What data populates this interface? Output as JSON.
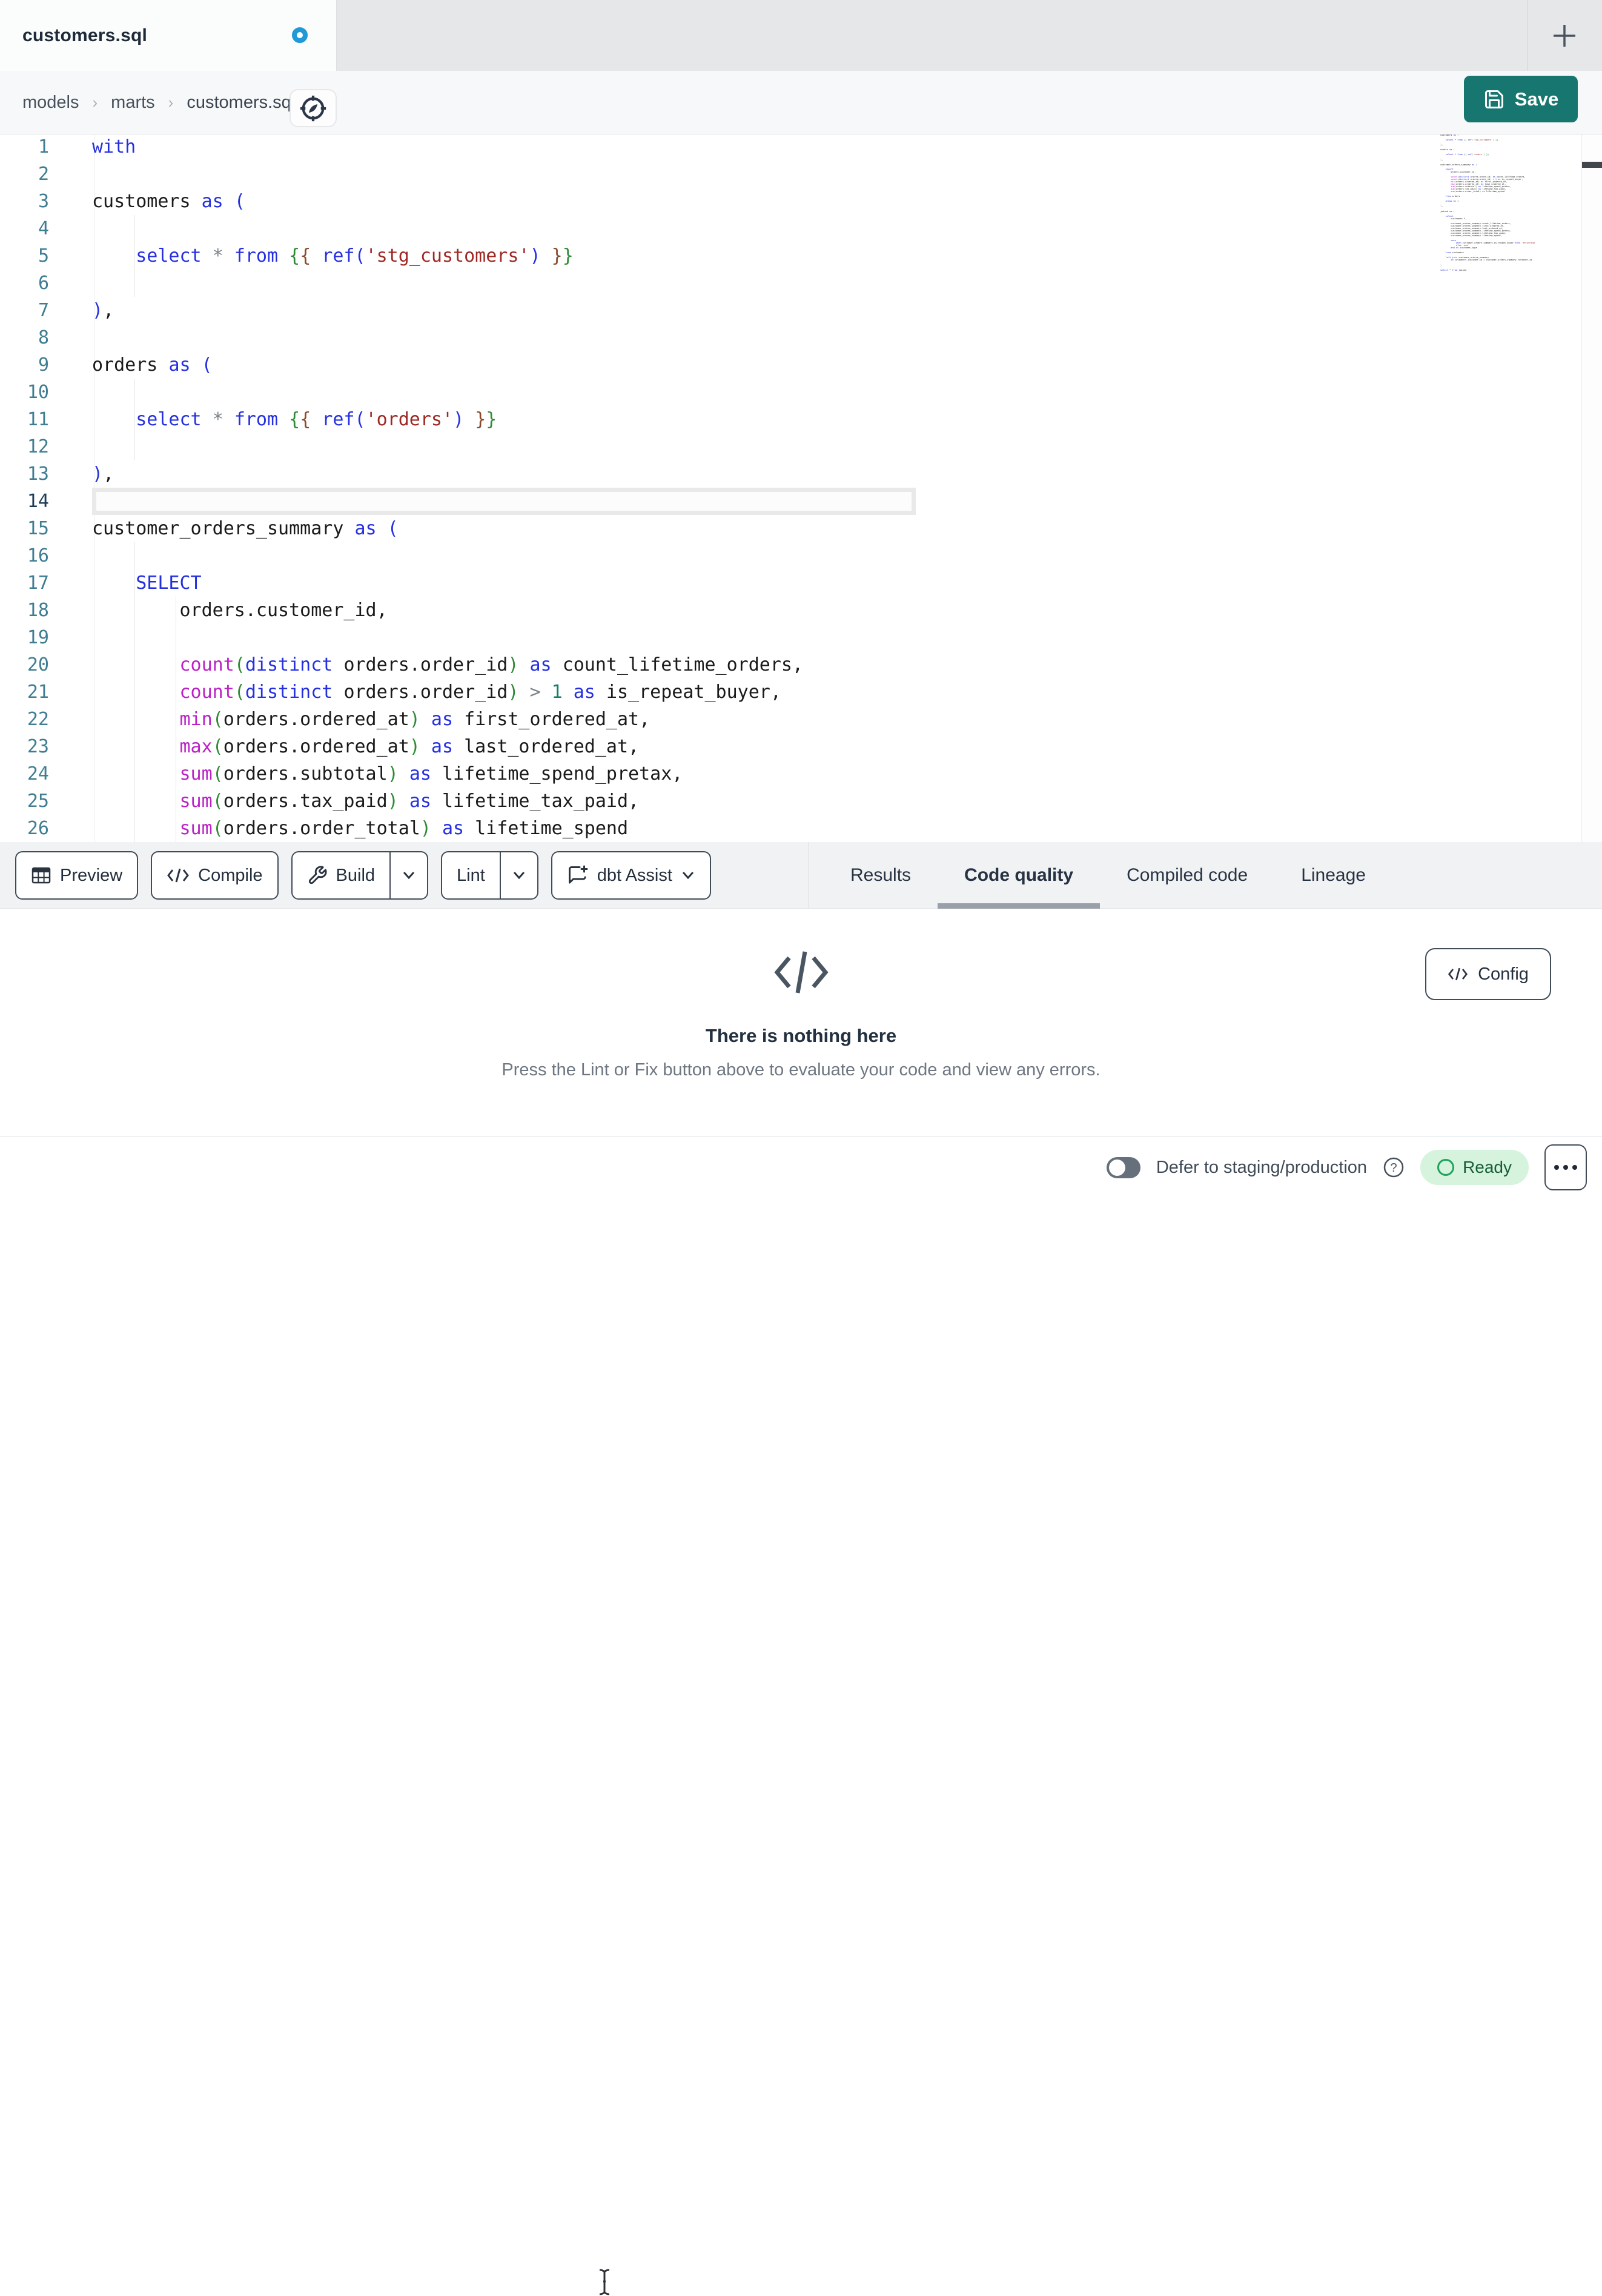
{
  "tab_bar": {
    "title": "customers.sql"
  },
  "breadcrumb": {
    "items": [
      "models",
      "marts",
      "customers.sql"
    ],
    "separator": "›"
  },
  "save_button": {
    "label": "Save"
  },
  "toolbar": {
    "preview_label": "Preview",
    "compile_label": "Compile",
    "build_label": "Build",
    "lint_label": "Lint",
    "assist_label": "dbt Assist"
  },
  "tabs": {
    "active_index": 1,
    "items": [
      {
        "label": "Results"
      },
      {
        "label": "Code quality"
      },
      {
        "label": "Compiled code"
      },
      {
        "label": "Lineage"
      }
    ]
  },
  "empty_state": {
    "title": "There is nothing here",
    "subtitle": "Press the Lint or Fix button above to evaluate your code and view any errors."
  },
  "config_button": {
    "label": "Config"
  },
  "status_bar": {
    "defer_label": "Defer to staging/production",
    "ready_label": "Ready"
  },
  "colors": {
    "accent_teal": "#17766f",
    "unsaved_dot_blue": "#1f9ad6",
    "ready_green_bg": "#d5f3dd",
    "ready_green_text": "#185f38",
    "keyword_blue": "#2430e0",
    "function_magenta": "#bb21c7",
    "string_red": "#9e2823",
    "bracket_green": "#2e8b35",
    "bracket_brown": "#884a2c",
    "line_number_teal": "#3f7d92"
  },
  "editor": {
    "active_line": 14,
    "lines": [
      [
        [
          "with",
          "kw"
        ]
      ],
      [],
      [
        [
          "customers"
        ],
        [
          " "
        ],
        [
          "as",
          "kw"
        ],
        [
          " "
        ],
        [
          "(",
          "kw"
        ]
      ],
      [],
      [
        [
          "    "
        ],
        [
          "select",
          "kw"
        ],
        [
          " "
        ],
        [
          "*",
          "op"
        ],
        [
          " "
        ],
        [
          "from",
          "kw"
        ],
        [
          " "
        ],
        [
          "{",
          "bg"
        ],
        [
          "{",
          "bb"
        ],
        [
          " "
        ],
        [
          "ref",
          "kw"
        ],
        [
          "(",
          "kw"
        ],
        [
          "'stg_customers'",
          "str"
        ],
        [
          ")",
          "kw"
        ],
        [
          " "
        ],
        [
          "}",
          "bb"
        ],
        [
          "}",
          "bg"
        ]
      ],
      [],
      [
        [
          ")",
          "kw"
        ],
        [
          ","
        ]
      ],
      [],
      [
        [
          "orders"
        ],
        [
          " "
        ],
        [
          "as",
          "kw"
        ],
        [
          " "
        ],
        [
          "(",
          "kw"
        ]
      ],
      [],
      [
        [
          "    "
        ],
        [
          "select",
          "kw"
        ],
        [
          " "
        ],
        [
          "*",
          "op"
        ],
        [
          " "
        ],
        [
          "from",
          "kw"
        ],
        [
          " "
        ],
        [
          "{",
          "bg"
        ],
        [
          "{",
          "bb"
        ],
        [
          " "
        ],
        [
          "ref",
          "kw"
        ],
        [
          "(",
          "kw"
        ],
        [
          "'orders'",
          "str"
        ],
        [
          ")",
          "kw"
        ],
        [
          " "
        ],
        [
          "}",
          "bb"
        ],
        [
          "}",
          "bg"
        ]
      ],
      [],
      [
        [
          ")",
          "kw"
        ],
        [
          ","
        ]
      ],
      [],
      [
        [
          "customer_orders_summary"
        ],
        [
          " "
        ],
        [
          "as",
          "kw"
        ],
        [
          " "
        ],
        [
          "(",
          "kw"
        ]
      ],
      [],
      [
        [
          "    "
        ],
        [
          "SELECT",
          "kw"
        ]
      ],
      [
        [
          "        "
        ],
        [
          "orders.customer_id,"
        ]
      ],
      [],
      [
        [
          "        "
        ],
        [
          "count",
          "fn"
        ],
        [
          "(",
          "bg"
        ],
        [
          "distinct",
          "kw"
        ],
        [
          " "
        ],
        [
          "orders.order_id"
        ],
        [
          ")",
          "bg"
        ],
        [
          " "
        ],
        [
          "as",
          "kw"
        ],
        [
          " "
        ],
        [
          "count_lifetime_orders,"
        ]
      ],
      [
        [
          "        "
        ],
        [
          "count",
          "fn"
        ],
        [
          "(",
          "bg"
        ],
        [
          "distinct",
          "kw"
        ],
        [
          " "
        ],
        [
          "orders.order_id"
        ],
        [
          ")",
          "bg"
        ],
        [
          " "
        ],
        [
          ">",
          "op"
        ],
        [
          " "
        ],
        [
          "1",
          "num"
        ],
        [
          " "
        ],
        [
          "as",
          "kw"
        ],
        [
          " "
        ],
        [
          "is_repeat_buyer,"
        ]
      ],
      [
        [
          "        "
        ],
        [
          "min",
          "fn"
        ],
        [
          "(",
          "bg"
        ],
        [
          "orders.ordered_at"
        ],
        [
          ")",
          "bg"
        ],
        [
          " "
        ],
        [
          "as",
          "kw"
        ],
        [
          " "
        ],
        [
          "first_ordered_at,"
        ]
      ],
      [
        [
          "        "
        ],
        [
          "max",
          "fn"
        ],
        [
          "(",
          "bg"
        ],
        [
          "orders.ordered_at"
        ],
        [
          ")",
          "bg"
        ],
        [
          " "
        ],
        [
          "as",
          "kw"
        ],
        [
          " "
        ],
        [
          "last_ordered_at,"
        ]
      ],
      [
        [
          "        "
        ],
        [
          "sum",
          "fn"
        ],
        [
          "(",
          "bg"
        ],
        [
          "orders.subtotal"
        ],
        [
          ")",
          "bg"
        ],
        [
          " "
        ],
        [
          "as",
          "kw"
        ],
        [
          " "
        ],
        [
          "lifetime_spend_pretax,"
        ]
      ],
      [
        [
          "        "
        ],
        [
          "sum",
          "fn"
        ],
        [
          "(",
          "bg"
        ],
        [
          "orders.tax_paid"
        ],
        [
          ")",
          "bg"
        ],
        [
          " "
        ],
        [
          "as",
          "kw"
        ],
        [
          " "
        ],
        [
          "lifetime_tax_paid,"
        ]
      ],
      [
        [
          "        "
        ],
        [
          "sum",
          "fn"
        ],
        [
          "(",
          "bg"
        ],
        [
          "orders.order_total"
        ],
        [
          ")",
          "bg"
        ],
        [
          " "
        ],
        [
          "as",
          "kw"
        ],
        [
          " "
        ],
        [
          "lifetime_spend"
        ]
      ]
    ],
    "minimap_lines": [
      "with",
      "",
      "customers as (",
      "",
      "    select * from {{ ref('stg_customers') }}",
      "",
      "),",
      "",
      "orders as (",
      "",
      "    select * from {{ ref('orders') }}",
      "",
      "),",
      "",
      "customer_orders_summary as (",
      "",
      "    SELECT",
      "        orders.customer_id,",
      "",
      "        count(distinct orders.order_id) as count_lifetime_orders,",
      "        count(distinct orders.order_id) > 1 as is_repeat_buyer,",
      "        min(orders.ordered_at) as first_ordered_at,",
      "        max(orders.ordered_at) as last_ordered_at,",
      "        sum(orders.subtotal) as lifetime_spend_pretax,",
      "        sum(orders.tax_paid) as lifetime_tax_paid,",
      "        sum(orders.order_total) as lifetime_spend",
      "",
      "    from orders",
      "",
      "    group by 1",
      "",
      "),",
      "",
      "joined as (",
      "",
      "    select",
      "        customers.*,",
      "",
      "        customer_orders_summary.count_lifetime_orders,",
      "        customer_orders_summary.first_ordered_at,",
      "        customer_orders_summary.last_ordered_at,",
      "        customer_orders_summary.lifetime_spend_pretax,",
      "        customer_orders_summary.lifetime_tax_paid,",
      "        customer_orders_summary.lifetime_spend,",
      "",
      "        case",
      "            when customer_orders_summary.is_repeat_buyer then 'returning'",
      "            else 'new'",
      "        end as customer_type",
      "",
      "    from customers",
      "",
      "    left join customer_orders_summary",
      "        on customers.customer_id = customer_orders_summary.customer_id",
      "",
      ")",
      "",
      "select * from joined"
    ]
  }
}
